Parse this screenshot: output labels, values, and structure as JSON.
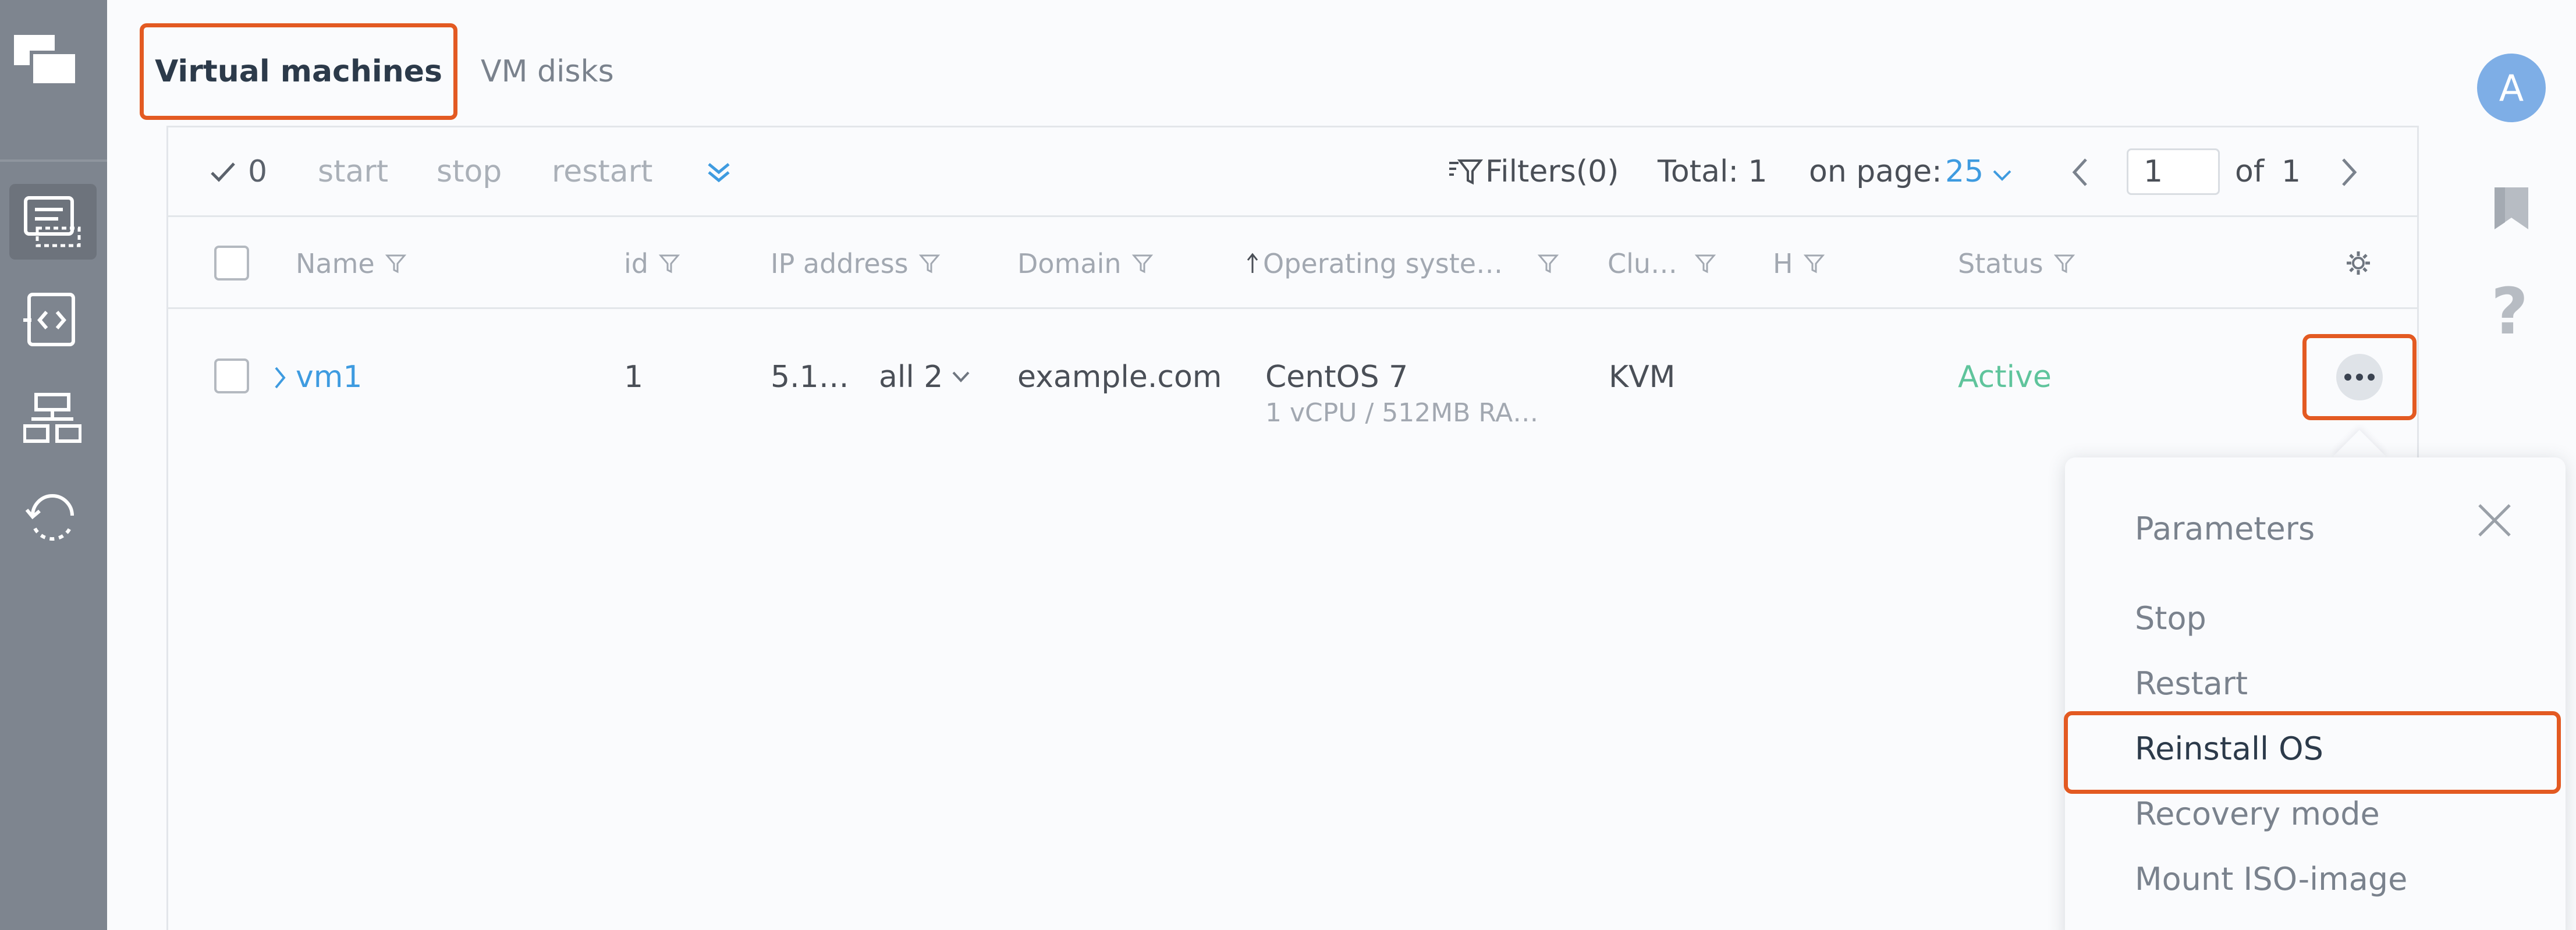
{
  "tabs": {
    "active": "Virtual machines",
    "second": "VM disks"
  },
  "user": {
    "avatar_letter": "A"
  },
  "toolbar": {
    "selected_count": "0",
    "start": "start",
    "stop": "stop",
    "restart": "restart",
    "filters": "Filters(0)",
    "total": "Total: 1",
    "on_page_label": "on page:",
    "on_page_value": "25",
    "page_current": "1",
    "of_label": "of",
    "page_total": "1"
  },
  "table": {
    "columns": [
      "Name",
      "id",
      "IP address",
      "Domain",
      "Operating syste…",
      "Clu…",
      "H",
      "Status"
    ],
    "rows": [
      {
        "name": "vm1",
        "id": "1",
        "ip": "5.1…",
        "ip_more": "all 2",
        "domain": "example.com",
        "os": "CentOS 7",
        "os_sub": "1 vCPU / 512MB RA…",
        "cluster": "KVM",
        "status": "Active"
      }
    ]
  },
  "menu": {
    "items": [
      "Parameters",
      "Stop",
      "Restart",
      "Reinstall OS",
      "Recovery mode",
      "Mount ISO-image"
    ]
  },
  "colors": {
    "accent": "#e35a22",
    "link": "#3e9be0",
    "status_active": "#5fc49c",
    "sidebar": "#7e858f"
  },
  "icons": {
    "sidebar": [
      "windows-icon",
      "vm-list-icon",
      "vm-code-icon",
      "network-icon",
      "backup-icon"
    ],
    "right_rail": [
      "bookmark-icon",
      "help-icon"
    ]
  }
}
